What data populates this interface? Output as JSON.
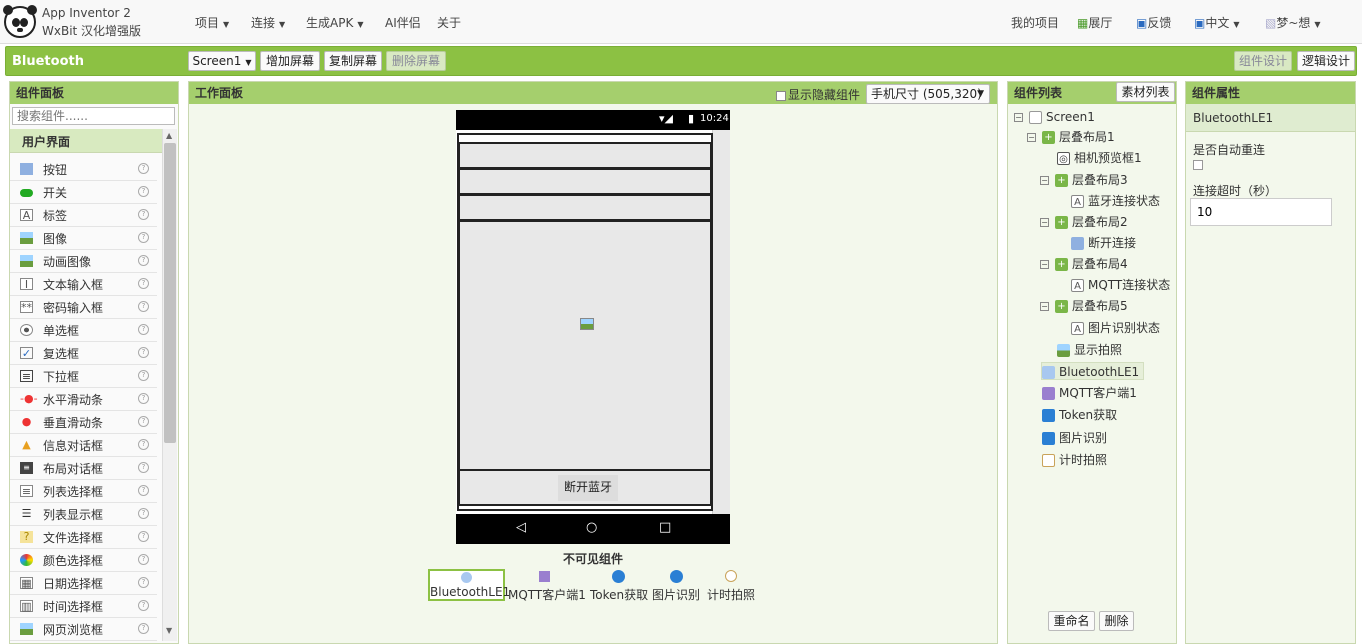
{
  "header": {
    "brand_line1": "App Inventor 2",
    "brand_line2": "WxBit 汉化增强版",
    "menus": [
      "项目",
      "连接",
      "生成APK",
      "AI伴侣",
      "关于"
    ],
    "right": {
      "my_projects": "我的项目",
      "gallery": "展厅",
      "feedback": "反馈",
      "language": "中文",
      "user": "梦~想"
    }
  },
  "project_bar": {
    "project_name": "Bluetooth",
    "screen_select": "Screen1",
    "add_screen": "增加屏幕",
    "copy_screen": "复制屏幕",
    "delete_screen": "删除屏幕",
    "designer": "组件设计",
    "blocks": "逻辑设计"
  },
  "palette": {
    "title": "组件面板",
    "search_placeholder": "搜索组件......",
    "category": "用户界面",
    "items": [
      {
        "label": "按钮",
        "icon": "button-icon"
      },
      {
        "label": "开关",
        "icon": "switch-icon"
      },
      {
        "label": "标签",
        "icon": "label-icon"
      },
      {
        "label": "图像",
        "icon": "image-icon"
      },
      {
        "label": "动画图像",
        "icon": "animated-image-icon"
      },
      {
        "label": "文本输入框",
        "icon": "textbox-icon"
      },
      {
        "label": "密码输入框",
        "icon": "password-icon"
      },
      {
        "label": "单选框",
        "icon": "radio-icon"
      },
      {
        "label": "复选框",
        "icon": "checkbox-icon"
      },
      {
        "label": "下拉框",
        "icon": "spinner-icon"
      },
      {
        "label": "水平滑动条",
        "icon": "hslider-icon"
      },
      {
        "label": "垂直滑动条",
        "icon": "vslider-icon"
      },
      {
        "label": "信息对话框",
        "icon": "notifier-icon"
      },
      {
        "label": "布局对话框",
        "icon": "layout-dialog-icon"
      },
      {
        "label": "列表选择框",
        "icon": "listpicker-icon"
      },
      {
        "label": "列表显示框",
        "icon": "listview-icon"
      },
      {
        "label": "文件选择框",
        "icon": "filepicker-icon"
      },
      {
        "label": "颜色选择框",
        "icon": "colorpicker-icon"
      },
      {
        "label": "日期选择框",
        "icon": "datepicker-icon"
      },
      {
        "label": "时间选择框",
        "icon": "timepicker-icon"
      },
      {
        "label": "网页浏览框",
        "icon": "webviewer-icon"
      }
    ]
  },
  "viewer": {
    "title": "工作面板",
    "show_hidden": "显示隐藏组件",
    "size_select": "手机尺寸 (505,320)",
    "status_time": "10:24",
    "button_text": "断开蓝牙",
    "nonvisible_title": "不可见组件",
    "nonvisible": [
      {
        "label": "BluetoothLE1",
        "icon": "bluetooth-icon"
      },
      {
        "label": "MQTT客户端1",
        "icon": "mqtt-icon"
      },
      {
        "label": "Token获取",
        "icon": "globe-icon"
      },
      {
        "label": "图片识别",
        "icon": "globe-icon"
      },
      {
        "label": "计时拍照",
        "icon": "clock-icon"
      }
    ]
  },
  "components": {
    "title": "组件列表",
    "media_button": "素材列表",
    "tree": [
      {
        "label": "Screen1",
        "icon": "screen-icon",
        "toggle": "⊟"
      },
      {
        "label": "层叠布局1",
        "icon": "layout-icon",
        "toggle": "⊟"
      },
      {
        "label": "相机预览框1",
        "icon": "camera-icon",
        "toggle": ""
      },
      {
        "label": "层叠布局3",
        "icon": "layout-icon",
        "toggle": "⊟"
      },
      {
        "label": "蓝牙连接状态",
        "icon": "label-icon",
        "toggle": ""
      },
      {
        "label": "层叠布局2",
        "icon": "layout-icon",
        "toggle": "⊟"
      },
      {
        "label": "断开连接",
        "icon": "button-icon",
        "toggle": ""
      },
      {
        "label": "层叠布局4",
        "icon": "layout-icon",
        "toggle": "⊟"
      },
      {
        "label": "MQTT连接状态",
        "icon": "label-icon",
        "toggle": ""
      },
      {
        "label": "层叠布局5",
        "icon": "layout-icon",
        "toggle": "⊟"
      },
      {
        "label": "图片识别状态",
        "icon": "label-icon",
        "toggle": ""
      },
      {
        "label": "显示拍照",
        "icon": "image-icon",
        "toggle": ""
      },
      {
        "label": "BluetoothLE1",
        "icon": "bluetooth-icon",
        "toggle": ""
      },
      {
        "label": "MQTT客户端1",
        "icon": "mqtt-icon",
        "toggle": ""
      },
      {
        "label": "Token获取",
        "icon": "globe-icon",
        "toggle": ""
      },
      {
        "label": "图片识别",
        "icon": "globe-icon",
        "toggle": ""
      },
      {
        "label": "计时拍照",
        "icon": "clock-icon",
        "toggle": ""
      }
    ],
    "rename": "重命名",
    "delete": "删除"
  },
  "properties": {
    "title": "组件属性",
    "component": "BluetoothLE1",
    "auto_reconnect_label": "是否自动重连",
    "timeout_label": "连接超时（秒）",
    "timeout_value": "10"
  }
}
